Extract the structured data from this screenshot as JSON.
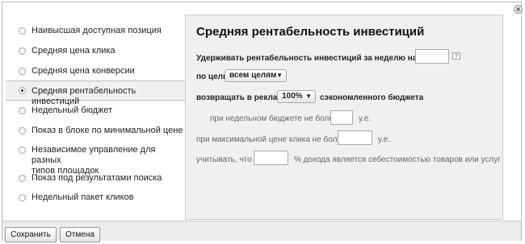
{
  "sidebar": {
    "items": [
      {
        "label": "Наивысшая доступная позиция",
        "label2": ""
      },
      {
        "label": "Средняя цена клика",
        "label2": ""
      },
      {
        "label": "Средняя цена конверсии",
        "label2": ""
      },
      {
        "label": "Средняя рентабельность инвестиций",
        "label2": ""
      },
      {
        "label": "Недельный бюджет",
        "label2": ""
      },
      {
        "label": "Показ в блоке по минимальной цене",
        "label2": ""
      },
      {
        "label": "Независимое управление для разных",
        "label2": "типов площадок"
      },
      {
        "label": "Показ под результатами поиска",
        "label2": ""
      },
      {
        "label": "Недельный пакет кликов",
        "label2": ""
      }
    ],
    "selected_index": 3
  },
  "panel": {
    "title": "Средняя рентабельность инвестиций",
    "hold_label": "Удерживать рентабельность инвестиций за неделю на уровне",
    "hold_value": "",
    "help_icon": "?",
    "goal_label": "по цели",
    "goal_select": "всем целям",
    "return_label": "возвращать в рекламу",
    "return_select": "100%",
    "return_suffix": "сэкономленного бюджета",
    "budget_label": "при недельном бюджете не более",
    "budget_value": "",
    "budget_unit": "у.е.",
    "maxprice_label": "при максимальной цене клика не более",
    "maxprice_value": "",
    "maxprice_unit": "у.е.",
    "account_label": "учитывать, что",
    "account_value": "",
    "account_suffix": "% дохода является себестоимостью товаров или услуг"
  },
  "footer": {
    "save_label": "Сохранить",
    "cancel_label": "Отмена"
  },
  "icons": {
    "close": "close-icon",
    "help": "help-icon",
    "chevron": "chevron-down-icon"
  }
}
